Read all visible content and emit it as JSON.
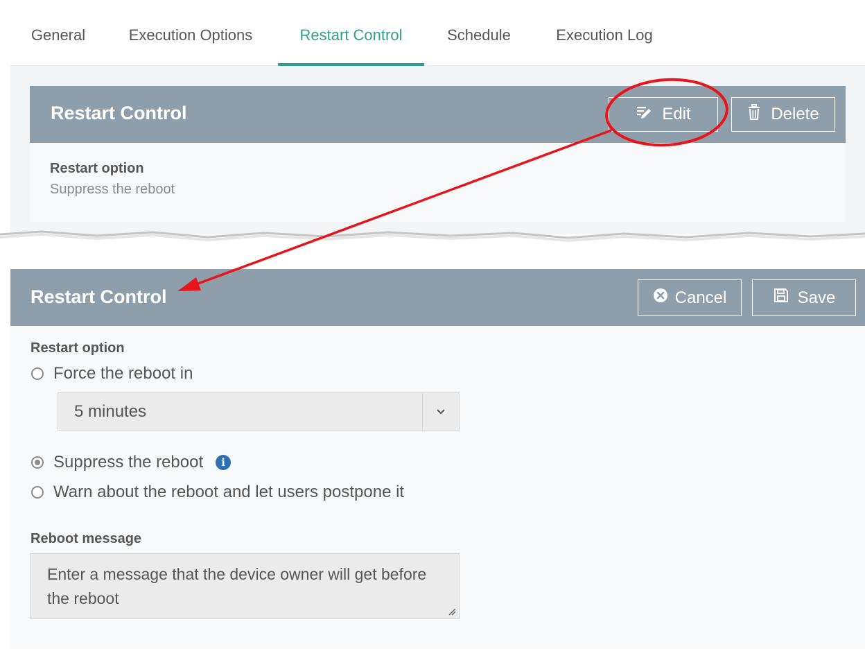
{
  "tabs": [
    {
      "label": "General",
      "active": false
    },
    {
      "label": "Execution Options",
      "active": false
    },
    {
      "label": "Restart Control",
      "active": true
    },
    {
      "label": "Schedule",
      "active": false
    },
    {
      "label": "Execution Log",
      "active": false
    }
  ],
  "view_card": {
    "title": "Restart Control",
    "edit_label": "Edit",
    "delete_label": "Delete",
    "field_label": "Restart option",
    "field_value": "Suppress the reboot"
  },
  "edit_card": {
    "title": "Restart Control",
    "cancel_label": "Cancel",
    "save_label": "Save",
    "restart_option_label": "Restart option",
    "options": [
      {
        "label": "Force the reboot in",
        "selected": false
      },
      {
        "label": "Suppress the reboot",
        "selected": true
      },
      {
        "label": "Warn about the reboot and let users postpone it",
        "selected": false
      }
    ],
    "delay_select_value": "5 minutes",
    "reboot_message_label": "Reboot message",
    "reboot_message_placeholder": "Enter a message that the device owner will get before the reboot"
  },
  "colors": {
    "accent": "#2e9f8a",
    "header_bg": "#8f9eab",
    "annotation": "#e8141c",
    "info": "#2f6fb4"
  }
}
